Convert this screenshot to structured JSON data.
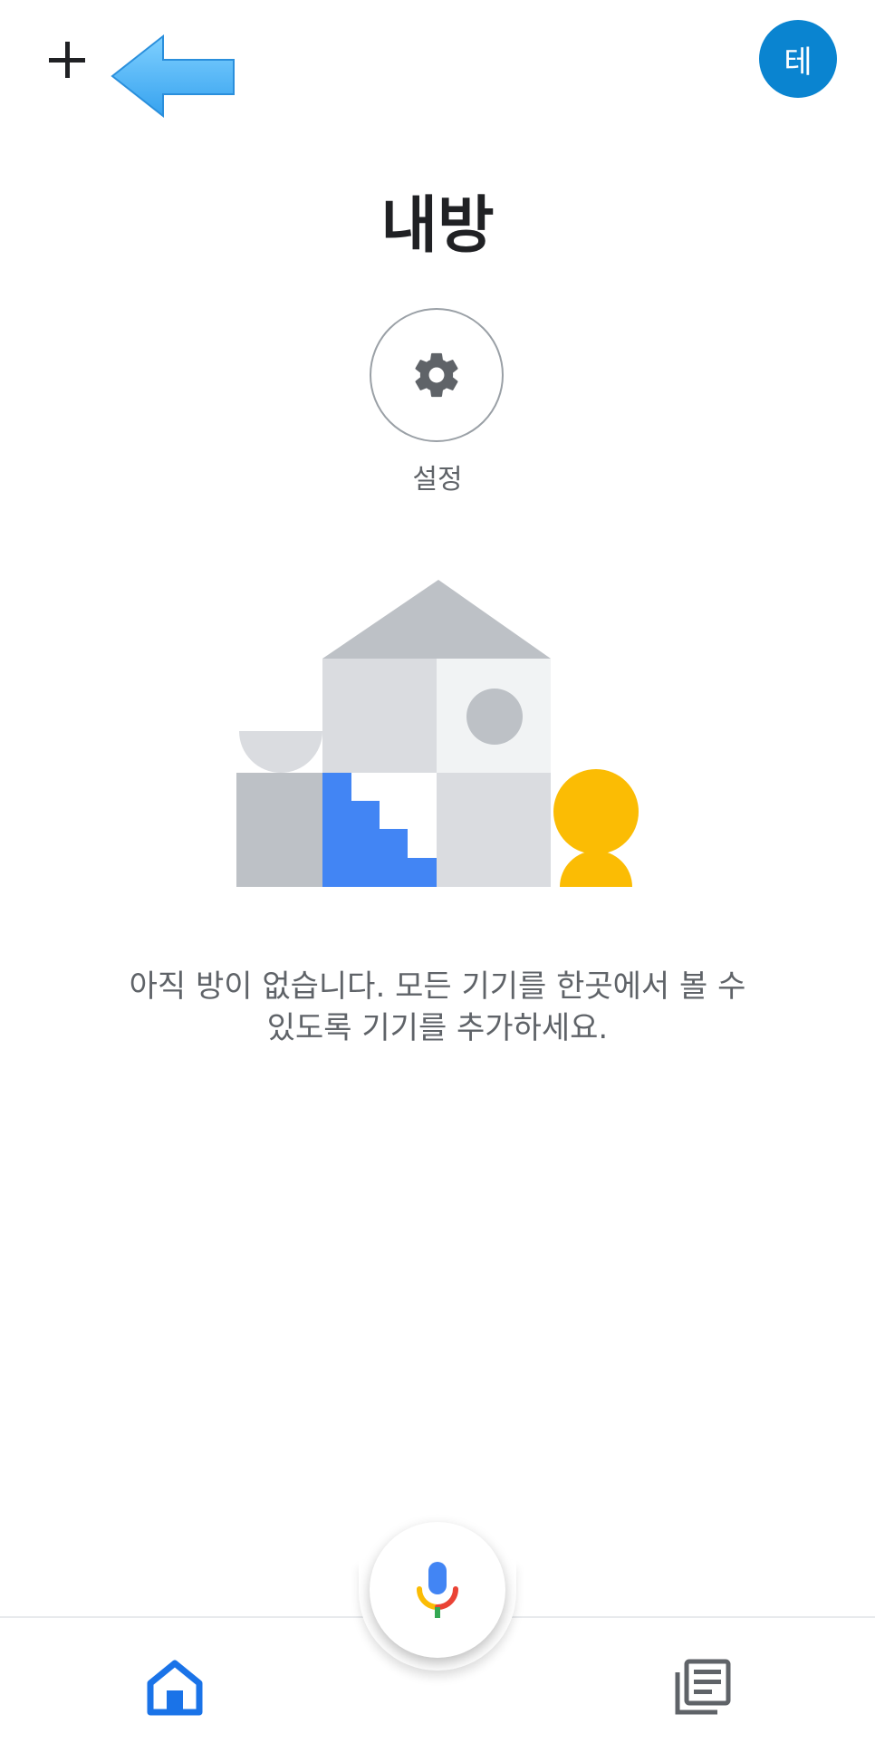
{
  "header": {
    "add_icon": "plus-icon",
    "annotation_icon": "left-arrow-icon",
    "annotation_color": "#4fb3f5",
    "avatar_initial": "테",
    "avatar_color": "#0a84d0"
  },
  "main": {
    "title": "내방",
    "settings": {
      "icon": "gear-icon",
      "label": "설정"
    },
    "empty_state": {
      "line1": "아직 방이 없습니다. 모든 기기를 한곳에서 볼 수",
      "line2": "있도록 기기를 추가하세요.",
      "illustration_colors": {
        "roof": "#bdc1c6",
        "block_light": "#dadce0",
        "block_pale": "#f1f3f4",
        "stairs": "#4285f4",
        "person": "#fbbc04"
      }
    }
  },
  "bottom_nav": {
    "home_icon": "home-icon",
    "mic_icon": "microphone-icon",
    "feed_icon": "feed-icon",
    "active_color": "#1a73e8"
  }
}
